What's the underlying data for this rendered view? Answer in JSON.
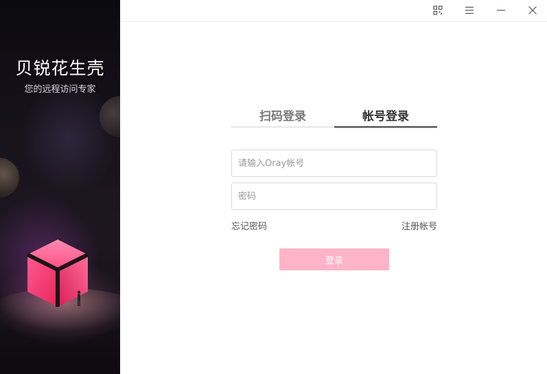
{
  "brand": {
    "title": "贝锐花生壳",
    "slogan": "您的远程访问专家"
  },
  "window_controls": {
    "qrcode": "qrcode-icon",
    "menu": "menu-icon",
    "minimize": "minimize-icon",
    "close": "close-icon"
  },
  "tabs": [
    {
      "label": "扫码登录",
      "active": false
    },
    {
      "label": "帐号登录",
      "active": true
    }
  ],
  "form": {
    "account_placeholder": "请输入Oray帐号",
    "account_value": "",
    "password_placeholder": "密码",
    "password_value": ""
  },
  "links": {
    "forgot_password": "忘记密码",
    "register": "注册帐号"
  },
  "login_button": {
    "label": "登录",
    "color": "#ffb3c9"
  },
  "colors": {
    "accent_pink": "#ff3f78",
    "active_tab_underline": "#444444"
  }
}
